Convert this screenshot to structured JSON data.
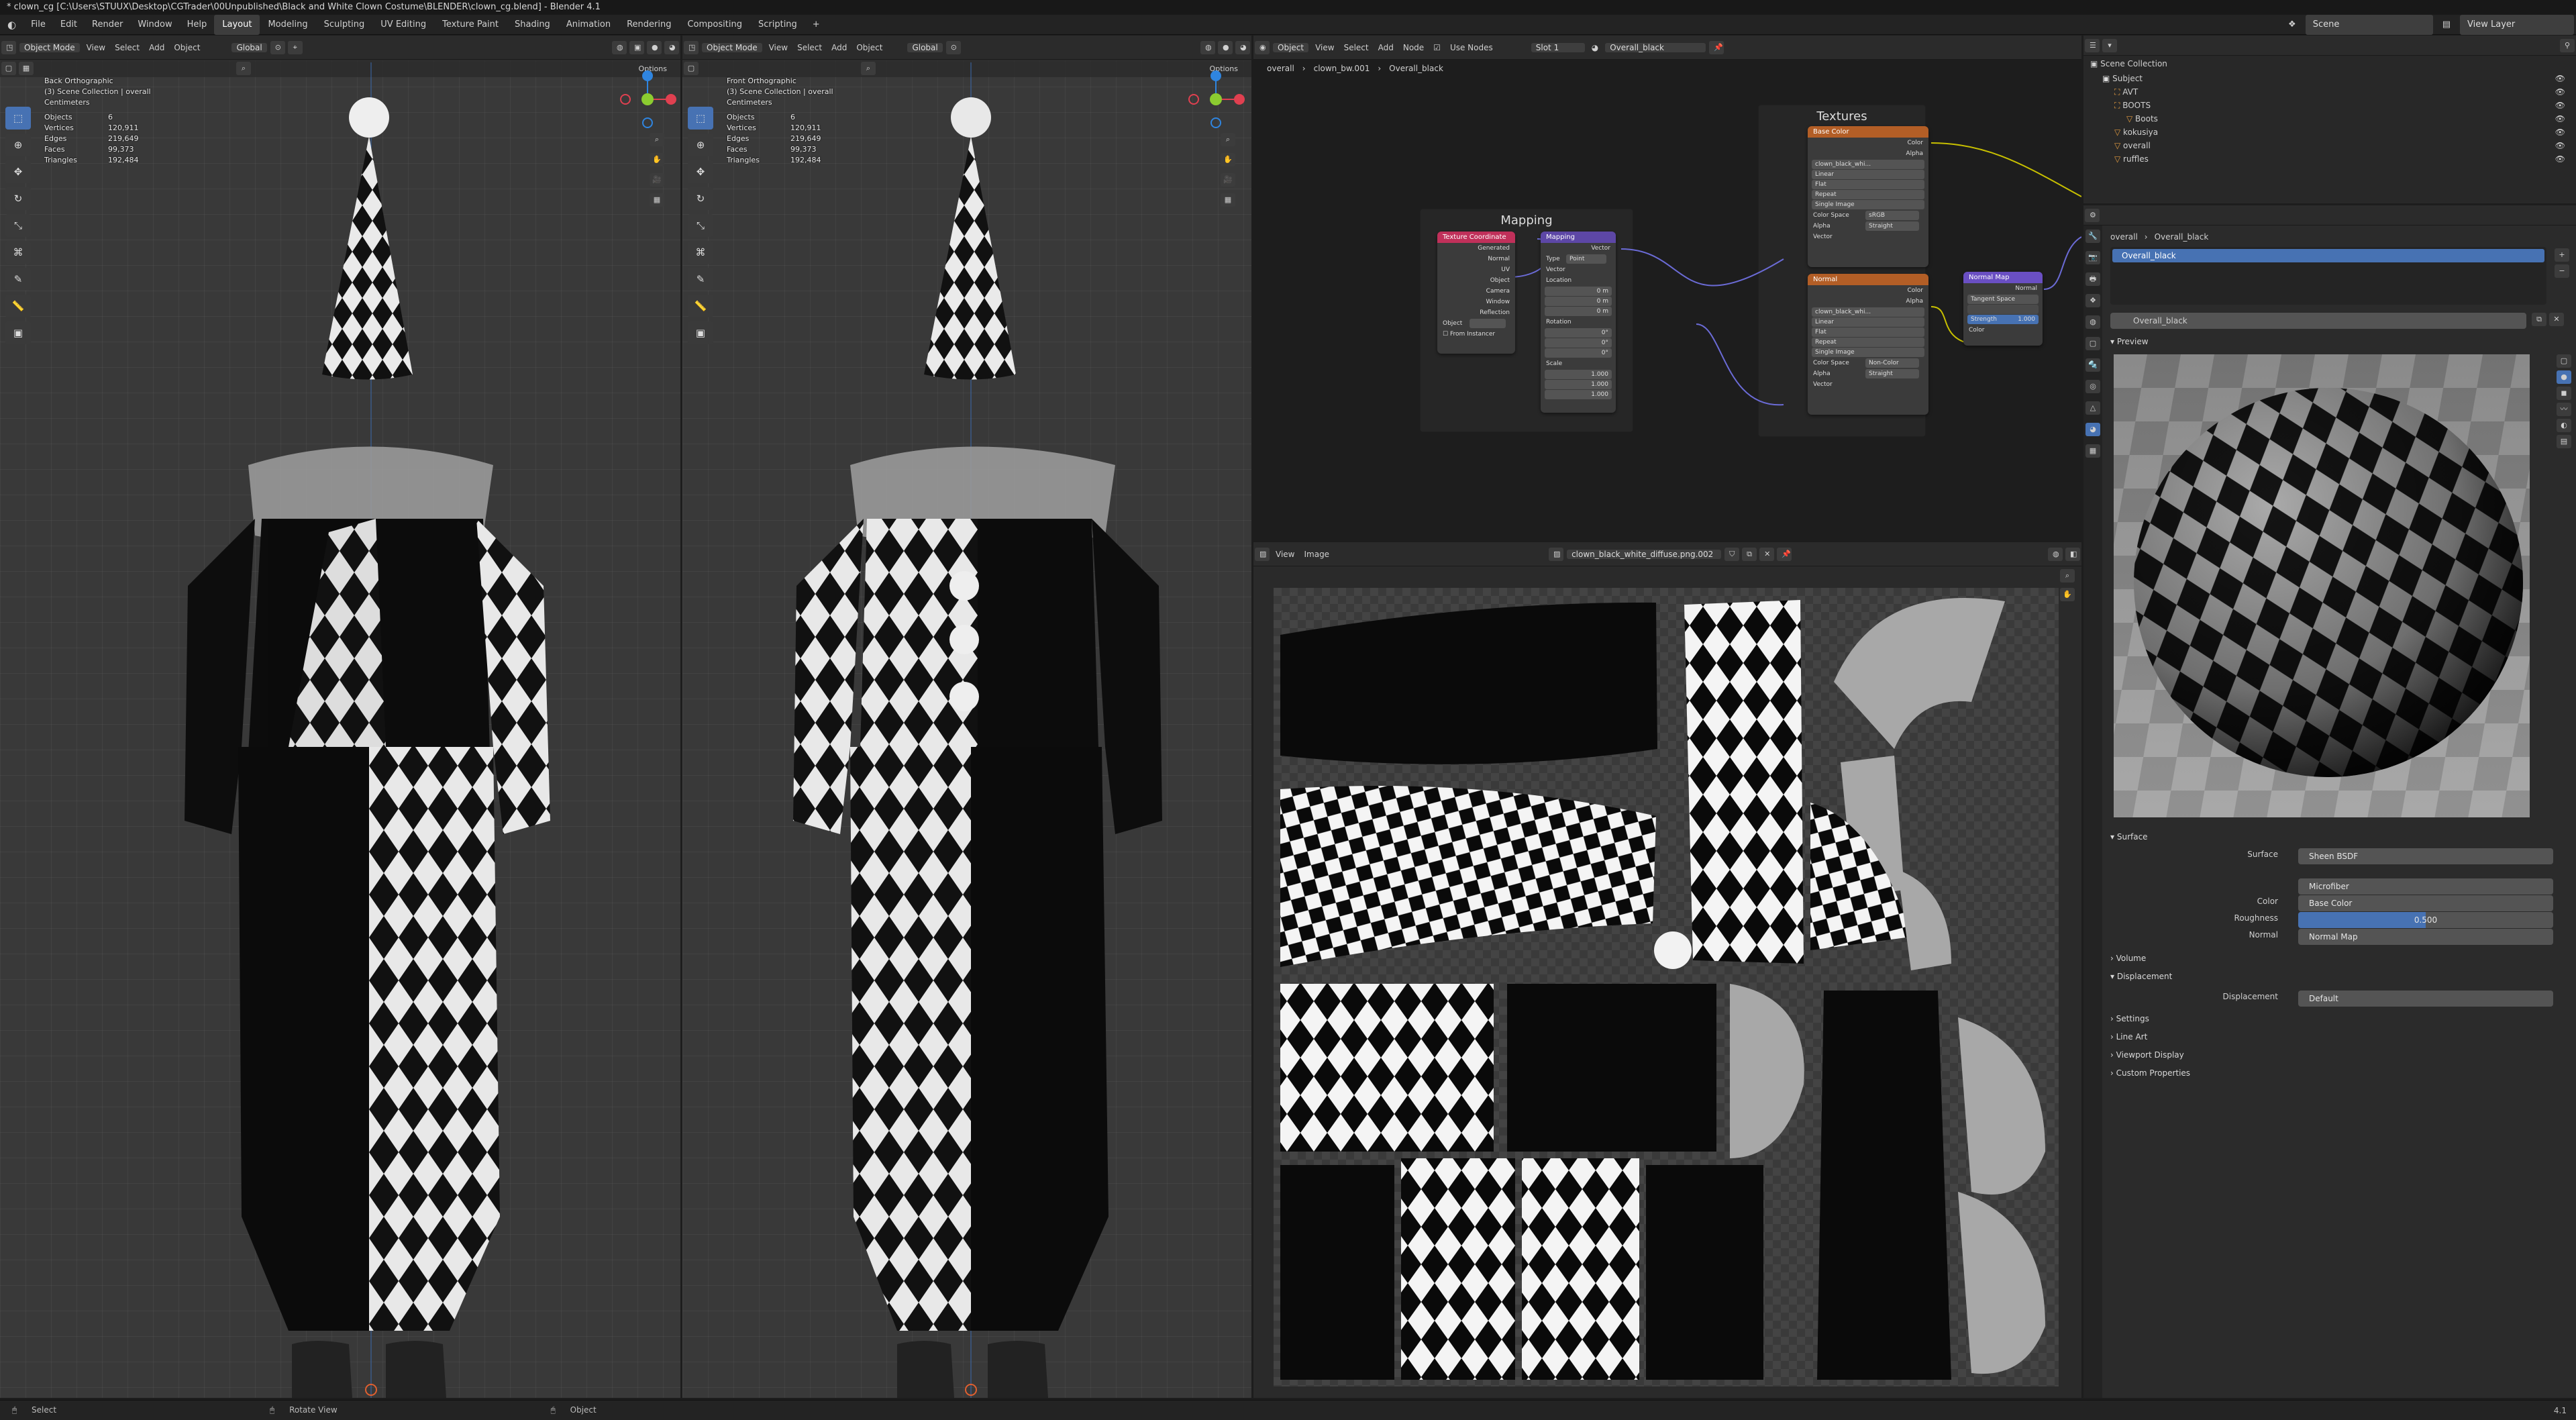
{
  "window_title": "* clown_cg [C:\\Users\\STUUX\\Desktop\\CGTrader\\00Unpublished\\Black and White Clown Costume\\BLENDER\\clown_cg.blend] - Blender 4.1",
  "menu": [
    "File",
    "Edit",
    "Render",
    "Window",
    "Help"
  ],
  "workspaces": [
    "Layout",
    "Modeling",
    "Sculpting",
    "UV Editing",
    "Texture Paint",
    "Shading",
    "Animation",
    "Rendering",
    "Compositing",
    "Scripting"
  ],
  "active_workspace": "Layout",
  "scene": "Scene",
  "view_layer": "View Layer",
  "viewport_header": {
    "mode": "Object Mode",
    "view": "View",
    "select": "Select",
    "add": "Add",
    "object": "Object",
    "orientation": "Global",
    "options": "Options"
  },
  "viewport_left": {
    "view_name": "Back Orthographic",
    "collection": "(3) Scene Collection | overall",
    "units": "Centimeters",
    "stats": [
      [
        "Objects",
        "6"
      ],
      [
        "Vertices",
        "120,911"
      ],
      [
        "Edges",
        "219,649"
      ],
      [
        "Faces",
        "99,373"
      ],
      [
        "Triangles",
        "192,484"
      ]
    ]
  },
  "viewport_right": {
    "view_name": "Front Orthographic",
    "collection": "(3) Scene Collection | overall",
    "units": "Centimeters",
    "stats": [
      [
        "Objects",
        "6"
      ],
      [
        "Vertices",
        "120,911"
      ],
      [
        "Edges",
        "219,649"
      ],
      [
        "Faces",
        "99,373"
      ],
      [
        "Triangles",
        "192,484"
      ]
    ]
  },
  "node_editor": {
    "header": {
      "type": "Object",
      "view": "View",
      "select": "Select",
      "add": "Add",
      "node": "Node",
      "use_nodes": "Use Nodes",
      "slot": "Slot 1",
      "material": "Overall_black"
    },
    "breadcrumb": [
      "overall",
      "clown_bw.001",
      "Overall_black"
    ],
    "frames": [
      "Mapping",
      "Textures"
    ],
    "tex_coord": {
      "title": "Texture Coordinate",
      "outputs": [
        "Generated",
        "Normal",
        "UV",
        "Object",
        "Camera",
        "Window",
        "Reflection"
      ],
      "object_label": "Object",
      "from_instancer": "From Instancer"
    },
    "mapping": {
      "title": "Mapping",
      "output": "Vector",
      "type_label": "Type",
      "type_value": "Point",
      "input": "Vector",
      "location": "Location",
      "loc": [
        "0 m",
        "0 m",
        "0 m"
      ],
      "rotation": "Rotation",
      "rot": [
        "0°",
        "0°",
        "0°"
      ],
      "scale": "Scale",
      "scl": [
        "1.000",
        "1.000",
        "1.000"
      ]
    },
    "base_color_tex": {
      "title": "Base Color",
      "image": "clown_black_whi...",
      "outputs": [
        "Color",
        "Alpha"
      ],
      "interp": "Linear",
      "proj": "Flat",
      "ext": "Repeat",
      "source": "Single Image",
      "cs_label": "Color Space",
      "cs_value": "sRGB",
      "alpha_label": "Alpha",
      "alpha_value": "Straight",
      "input": "Vector"
    },
    "normal_tex": {
      "title": "Normal",
      "image": "clown_black_whi...",
      "outputs": [
        "Color",
        "Alpha"
      ],
      "interp": "Linear",
      "proj": "Flat",
      "ext": "Repeat",
      "source": "Single Image",
      "cs_label": "Color Space",
      "cs_value": "Non-Color",
      "alpha_label": "Alpha",
      "alpha_value": "Straight",
      "input": "Vector"
    },
    "normal_map": {
      "title": "Normal Map",
      "output": "Normal",
      "space": "Tangent Space",
      "strength_label": "Strength",
      "strength": "1.000",
      "input": "Color"
    }
  },
  "image_editor": {
    "view": "View",
    "image_menu": "Image",
    "image_name": "clown_black_white_diffuse.png.002"
  },
  "outliner": {
    "title": "Scene Collection",
    "items": [
      {
        "label": "Subject",
        "indent": 1,
        "icon": "collection"
      },
      {
        "label": "AVT",
        "indent": 2,
        "icon": "armature"
      },
      {
        "label": "BOOTS",
        "indent": 2,
        "icon": "armature"
      },
      {
        "label": "Boots",
        "indent": 3,
        "icon": "mesh"
      },
      {
        "label": "kokusiya",
        "indent": 2,
        "icon": "mesh"
      },
      {
        "label": "overall",
        "indent": 2,
        "icon": "mesh"
      },
      {
        "label": "ruffles",
        "indent": 2,
        "icon": "mesh"
      }
    ]
  },
  "properties": {
    "breadcrumb": [
      "overall",
      "Overall_black"
    ],
    "material_slot": "Overall_black",
    "material_name": "Overall_black",
    "preview": "Preview",
    "surface_section": "Surface",
    "rows": [
      {
        "label": "Surface",
        "value": "Sheen BSDF"
      },
      {
        "label": "",
        "value": "Microfiber"
      },
      {
        "label": "Color",
        "value": "Base Color"
      },
      {
        "label": "Roughness",
        "value": "0.500"
      },
      {
        "label": "Normal",
        "value": "Normal Map"
      }
    ],
    "roughness": 0.5,
    "sections": [
      "Volume",
      "Displacement",
      "Settings",
      "Line Art",
      "Viewport Display",
      "Custom Properties"
    ],
    "displacement_label": "Displacement",
    "displacement_value": "Default"
  },
  "statusbar": [
    "Select",
    "Rotate View",
    "Object"
  ],
  "version": "4.1",
  "colors": {
    "accent": "#4772b3",
    "tex_header": "#b35e26",
    "mapping_header": "#5d47a6",
    "coord_header": "#c0305a",
    "vector_header": "#6a4fc3",
    "link_yellow": "#c8c000",
    "link_purple": "#6b6bd6"
  }
}
